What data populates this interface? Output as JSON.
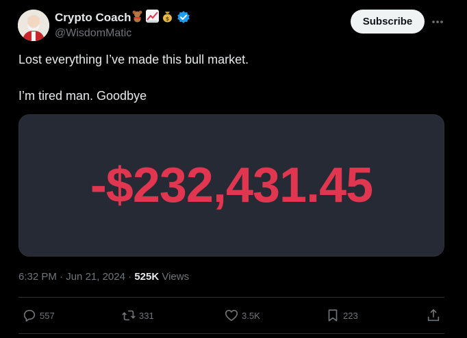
{
  "author": {
    "display_name": "Crypto Coach",
    "handle": "@WisdomMatic",
    "name_emojis": [
      "teddy-bear-emoji",
      "chart-increasing-emoji",
      "money-bag-emoji"
    ],
    "verified": true
  },
  "header": {
    "subscribe_label": "Subscribe",
    "more_icon": "ellipsis-icon"
  },
  "tweet": {
    "line1": "Lost everything I’ve made this bull market.",
    "line2": "I’m tired man. Goodbye",
    "media_text": "-$232,431.45"
  },
  "meta": {
    "time": "6:32 PM",
    "date": "Jun 21, 2024",
    "views_count": "525K",
    "views_label": "Views"
  },
  "actions": {
    "replies": "557",
    "reposts": "331",
    "likes": "3.5K",
    "bookmarks": "223"
  },
  "colors": {
    "background": "#000000",
    "text": "#e7e9ea",
    "muted": "#71767b",
    "media_bg": "#262a35",
    "loss_red": "#e0364f",
    "verified_blue": "#1d9bf0"
  }
}
